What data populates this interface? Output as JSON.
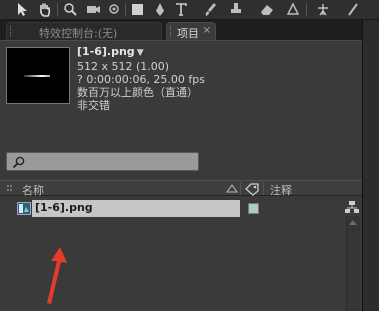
{
  "tabs": {
    "effects_label": "特效控制台:(无)",
    "project_label": "项目",
    "close_glyph": "×"
  },
  "asset": {
    "name": "[1-6].png",
    "dimensions": "512 x 512 (1.00)",
    "duration": "? 0:00:00:06, 25.00 fps",
    "color": "数百万以上颜色（直通）",
    "interlace": "非交错"
  },
  "search": {
    "placeholder": ""
  },
  "columns": {
    "name": "名称",
    "comment": "注释"
  },
  "items": [
    {
      "name": "[1-6].png",
      "label_color": "#a9cccc"
    }
  ],
  "icons": [
    "selection-icon",
    "hand-icon",
    "zoom-icon",
    "camera-icon",
    "pan-behind-icon",
    "rectangle-icon",
    "pen-icon",
    "text-icon",
    "brush-icon",
    "clone-icon",
    "eraser-icon",
    "puppet-icon",
    "search-icon",
    "label-tag-icon",
    "png-file-icon",
    "flowchart-icon",
    "panel-menu-icon"
  ],
  "colors": {
    "selected_row": "#c6c6c6",
    "annotation_arrow": "#e53a2e"
  }
}
